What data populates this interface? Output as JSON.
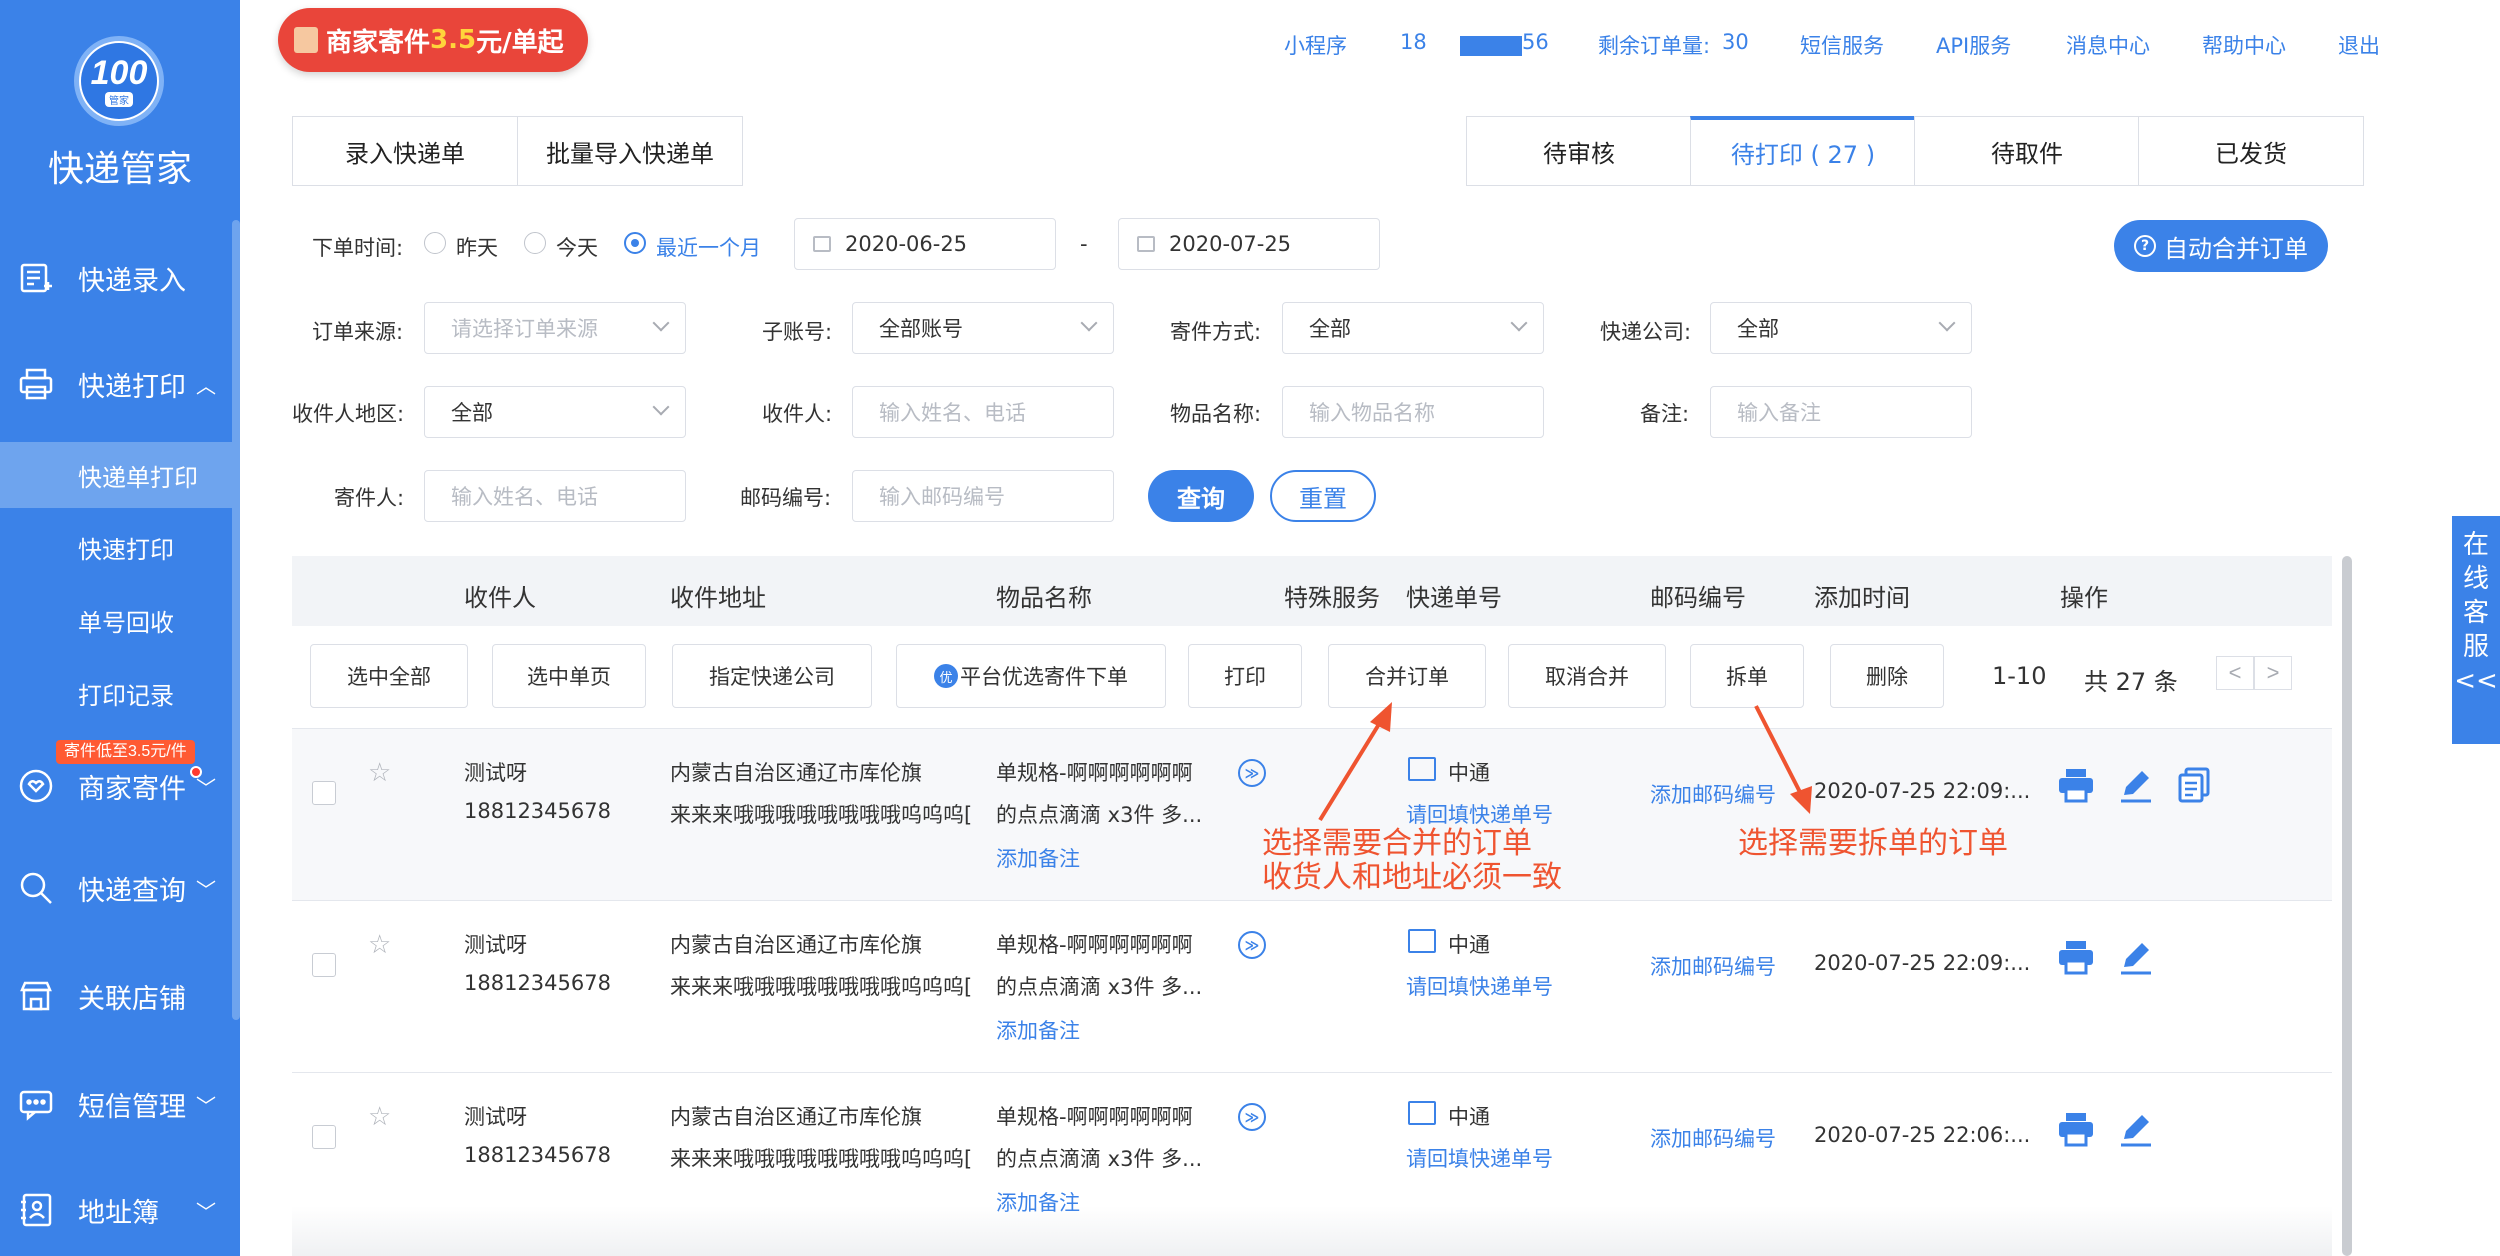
{
  "sidebar": {
    "logo_text": "100",
    "logo_sub": "管家",
    "title": "快递管家",
    "items": [
      {
        "label": "快递录入",
        "icon": "form-icon",
        "chevron": ""
      },
      {
        "label": "快递打印",
        "icon": "printer-icon",
        "chevron": "^"
      },
      {
        "label": "商家寄件",
        "icon": "heart-box-icon",
        "chevron": "v",
        "badge": "寄件低至3.5元/件"
      },
      {
        "label": "快递查询",
        "icon": "search-icon",
        "chevron": "v"
      },
      {
        "label": "关联店铺",
        "icon": "shop-icon",
        "chevron": ""
      },
      {
        "label": "短信管理",
        "icon": "message-icon",
        "chevron": "v"
      },
      {
        "label": "地址簿",
        "icon": "address-book-icon",
        "chevron": "v"
      }
    ],
    "subitems": [
      "快递单打印",
      "快速打印",
      "单号回收",
      "打印记录"
    ]
  },
  "banner": {
    "prefix": "商家寄件",
    "price": "3.5",
    "suffix": "元/单起"
  },
  "topnav": {
    "mini_program": "小程序",
    "phone_start": "18",
    "phone_end": "56",
    "remaining_label": "剩余订单量:",
    "remaining_value": "30",
    "sms": "短信服务",
    "api": "API服务",
    "messages": "消息中心",
    "help": "帮助中心",
    "logout": "退出"
  },
  "tabs_left": [
    "录入快递单",
    "批量导入快递单"
  ],
  "tabs_right": [
    "待审核",
    "待打印 ( 27 )",
    "待取件",
    "已发货"
  ],
  "filters": {
    "order_time_label": "下单时间:",
    "radios": [
      "昨天",
      "今天",
      "最近一个月"
    ],
    "date_start": "2020-06-25",
    "date_sep": "-",
    "date_end": "2020-07-25",
    "auto_merge": "自动合并订单",
    "source_label": "订单来源:",
    "source_placeholder": "请选择订单来源",
    "subaccount_label": "子账号:",
    "subaccount_value": "全部账号",
    "ship_method_label": "寄件方式:",
    "ship_method_value": "全部",
    "carrier_label": "快递公司:",
    "carrier_value": "全部",
    "region_label": "收件人地区:",
    "region_value": "全部",
    "recipient_label": "收件人:",
    "recipient_placeholder": "输入姓名、电话",
    "item_label": "物品名称:",
    "item_placeholder": "输入物品名称",
    "remark_label": "备注:",
    "remark_placeholder": "输入备注",
    "sender_label": "寄件人:",
    "sender_placeholder": "输入姓名、电话",
    "postcode_label": "邮码编号:",
    "postcode_placeholder": "输入邮码编号",
    "query": "查询",
    "reset": "重置"
  },
  "table": {
    "headers": [
      "收件人",
      "收件地址",
      "物品名称",
      "特殊服务",
      "快递单号",
      "邮码编号",
      "添加时间",
      "操作"
    ],
    "actions": [
      "选中全部",
      "选中单页",
      "指定快递公司",
      "平台优选寄件下单",
      "打印",
      "合并订单",
      "取消合并",
      "拆单",
      "删除"
    ],
    "preferred_badge": "优",
    "page_range": "1-10",
    "total": "共 27 条",
    "prev": "<",
    "next": ">",
    "rows": [
      {
        "name": "测试呀",
        "phone": "18812345678",
        "addr1": "内蒙古自治区通辽市库伦旗",
        "addr2": "来来来哦哦哦哦哦哦哦哦呜呜呜[",
        "item1": "单规格-啊啊啊啊啊啊",
        "item2": "的点点滴滴 x3件 多...",
        "add_note": "添加备注",
        "carrier": "中通",
        "fill_tracking": "请回填快递单号",
        "add_postcode": "添加邮码编号",
        "time": "2020-07-25 22:09:...",
        "copy": true
      },
      {
        "name": "测试呀",
        "phone": "18812345678",
        "addr1": "内蒙古自治区通辽市库伦旗",
        "addr2": "来来来哦哦哦哦哦哦哦哦呜呜呜[",
        "item1": "单规格-啊啊啊啊啊啊",
        "item2": "的点点滴滴 x3件 多...",
        "add_note": "添加备注",
        "carrier": "中通",
        "fill_tracking": "请回填快递单号",
        "add_postcode": "添加邮码编号",
        "time": "2020-07-25 22:09:...",
        "copy": false
      },
      {
        "name": "测试呀",
        "phone": "18812345678",
        "addr1": "内蒙古自治区通辽市库伦旗",
        "addr2": "来来来哦哦哦哦哦哦哦哦呜呜呜[",
        "item1": "单规格-啊啊啊啊啊啊",
        "item2": "的点点滴滴 x3件 多...",
        "add_note": "添加备注",
        "carrier": "中通",
        "fill_tracking": "请回填快递单号",
        "add_postcode": "添加邮码编号",
        "time": "2020-07-25 22:06:...",
        "copy": false
      }
    ]
  },
  "annotations": {
    "merge_line1": "选择需要合并的订单",
    "merge_line2": "收货人和地址必须一致",
    "split": "选择需要拆单的订单"
  },
  "online_service": [
    "在",
    "线",
    "客",
    "服",
    "<<"
  ],
  "colors": {
    "primary": "#3b82e8",
    "annotation": "#ef5430",
    "banner": "#e9453a"
  }
}
